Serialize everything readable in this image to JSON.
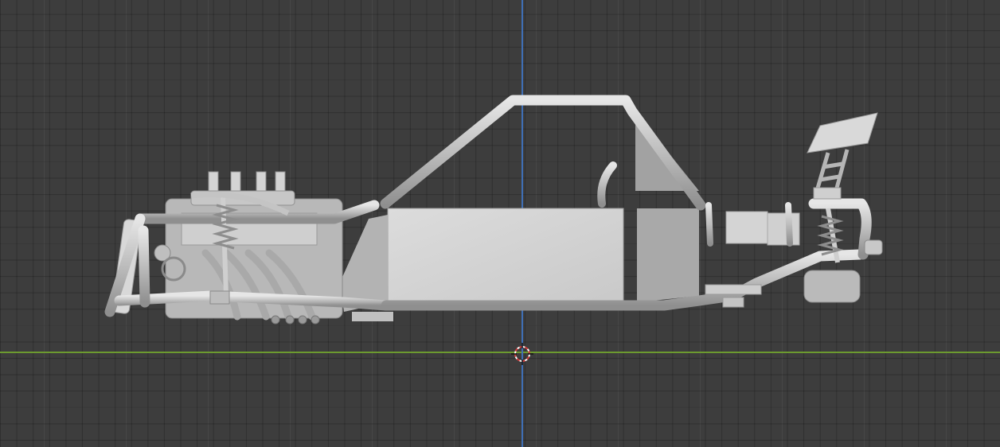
{
  "viewport": {
    "view": "side-orthographic",
    "background_color": "#3d3d3d",
    "grid": true,
    "axis_colors": {
      "x": "#6c9a2f",
      "z": "#3f6fb5"
    }
  },
  "model": {
    "object": "tube-frame-chassis",
    "shading": "solid",
    "color": "#c8c8c8"
  },
  "icons": {
    "cursor": "3d-cursor-icon"
  }
}
